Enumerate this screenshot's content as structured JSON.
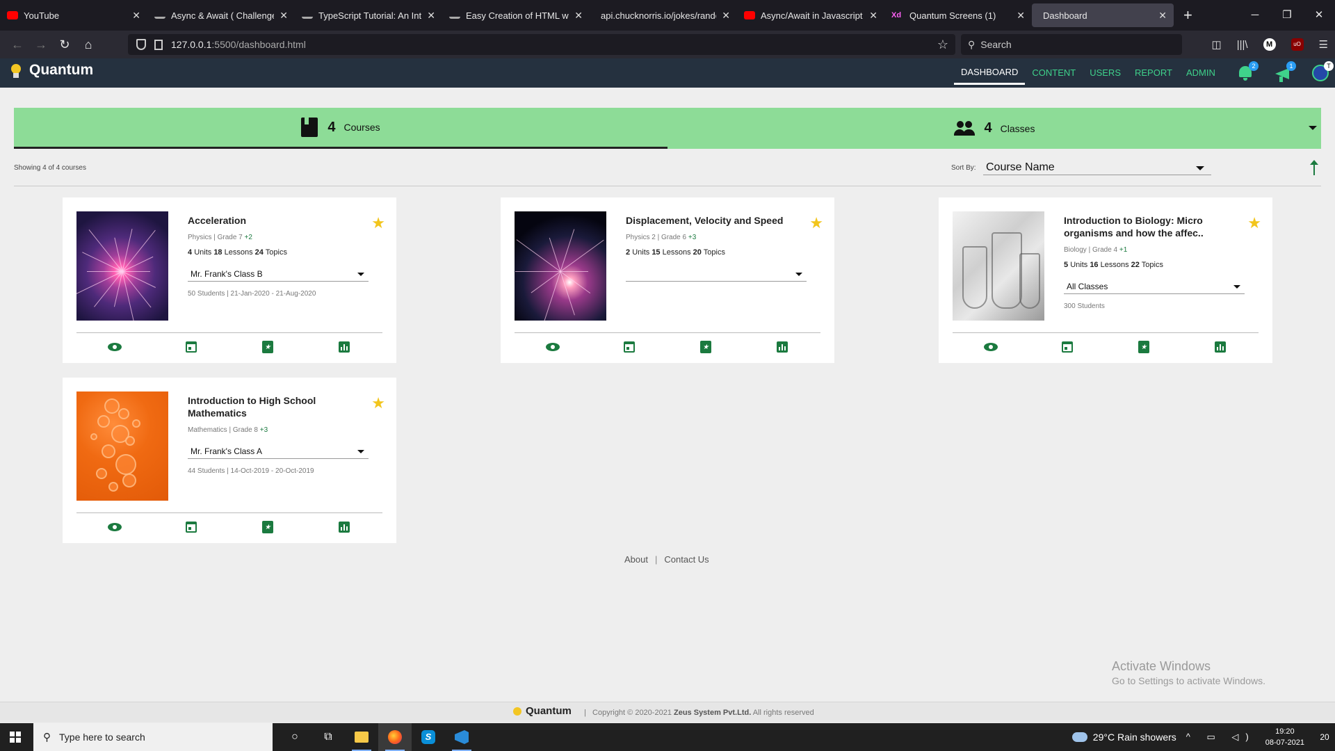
{
  "browser": {
    "tabs": [
      {
        "title": "YouTube",
        "favicon": "youtube-icon",
        "active": false
      },
      {
        "title": "Async & Await ( Challenge ) -",
        "favicon": "bar-icon",
        "active": false
      },
      {
        "title": "TypeScript Tutorial: An Intro T",
        "favicon": "bar-icon",
        "active": false
      },
      {
        "title": "Easy Creation of HTML with J",
        "favicon": "bar-icon",
        "active": false
      },
      {
        "title": "api.chucknorris.io/jokes/random",
        "favicon": "none",
        "active": false
      },
      {
        "title": "Async/Await in Javascript | Ja",
        "favicon": "youtube-icon",
        "active": false
      },
      {
        "title": "Quantum Screens (1)",
        "favicon": "xd-icon",
        "active": false
      },
      {
        "title": "Dashboard",
        "favicon": "none",
        "active": true
      }
    ],
    "xd_label": "Xd",
    "url_host": "127.0.0.1",
    "url_path": ":5500/dashboard.html",
    "search_placeholder": "Search",
    "profile_initial": "M",
    "ublock_label": "uO"
  },
  "app": {
    "brand": "Quantum",
    "nav": [
      {
        "label": "DASHBOARD",
        "active": true
      },
      {
        "label": "CONTENT",
        "active": false
      },
      {
        "label": "USERS",
        "active": false
      },
      {
        "label": "REPORT",
        "active": false
      },
      {
        "label": "ADMIN",
        "active": false
      }
    ],
    "notifications_count": "2",
    "announcements_count": "1",
    "accent_color": "#3fd28b"
  },
  "stats": {
    "courses_count": "4",
    "courses_label": "Courses",
    "classes_count": "4",
    "classes_label": "Classes"
  },
  "listing": {
    "showing_text": "Showing 4 of 4 courses",
    "sort_label": "Sort By:",
    "sort_value": "Course Name"
  },
  "courses": [
    {
      "title": "Acceleration",
      "subject": "Physics",
      "grade": "Grade 7",
      "grade_extra": "+2",
      "units": "4",
      "lessons": "18",
      "topics": "24",
      "class_selected": "Mr. Frank's Class B",
      "students": "50 Students",
      "dates": "21-Jan-2020 - 21-Aug-2020",
      "starred": true,
      "image": "plasma-ball"
    },
    {
      "title": "Displacement, Velocity and Speed",
      "subject": "Physics 2",
      "grade": "Grade 6",
      "grade_extra": "+3",
      "units": "2",
      "lessons": "15",
      "topics": "20",
      "class_selected": "",
      "students": "",
      "dates": "",
      "starred": true,
      "image": "plasma-globe"
    },
    {
      "title": "Introduction to Biology: Micro organisms and how the affec..",
      "subject": "Biology",
      "grade": "Grade 4",
      "grade_extra": "+1",
      "units": "5",
      "lessons": "16",
      "topics": "22",
      "class_selected": "All Classes",
      "students": "300 Students",
      "dates": "",
      "starred": true,
      "image": "lab-glassware"
    },
    {
      "title": "Introduction to High School Mathematics",
      "subject": "Mathematics",
      "grade": "Grade 8",
      "grade_extra": "+3",
      "units": "",
      "lessons": "",
      "topics": "",
      "class_selected": "Mr. Frank's Class A",
      "students": "44 Students",
      "dates": "14-Oct-2019 - 20-Oct-2019",
      "starred": true,
      "image": "orange-bubbles"
    }
  ],
  "count_labels": {
    "units": "Units",
    "lessons": "Lessons",
    "topics": "Topics"
  },
  "footer": {
    "about": "About",
    "contact": "Contact Us",
    "brand": "Quantum",
    "copyright_prefix": "Copyright © 2020-2021",
    "company": "Zeus System Pvt.Ltd.",
    "copyright_suffix": "All rights reserved"
  },
  "watermark": {
    "line1": "Activate Windows",
    "line2": "Go to Settings to activate Windows."
  },
  "taskbar": {
    "search_placeholder": "Type here to search",
    "weather": "29°C  Rain showers",
    "time": "19:20",
    "date": "08-07-2021",
    "notif_count": "20"
  }
}
